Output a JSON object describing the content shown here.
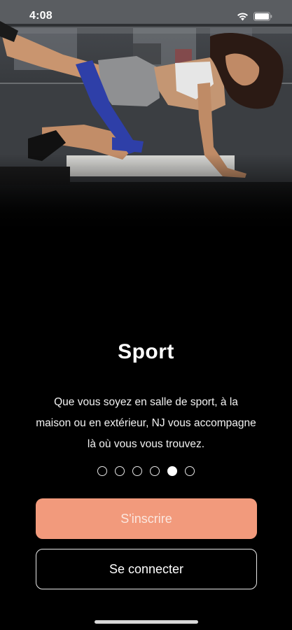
{
  "status_bar": {
    "time": "4:08"
  },
  "hero": {
    "image": "woman-exercising-with-resistance-band-photo"
  },
  "slide": {
    "title": "Sport",
    "description": "Que vous soyez en salle de sport, à la maison ou en extérieur, NJ vous accompagne là où vous vous trouvez."
  },
  "pagination": {
    "total": 6,
    "active_index": 4
  },
  "buttons": {
    "signup_label": "S'inscrire",
    "login_label": "Se connecter"
  },
  "colors": {
    "background": "#000000",
    "primary_button": "#f29a7c",
    "primary_button_text": "#fbe7df",
    "text": "#ffffff"
  }
}
